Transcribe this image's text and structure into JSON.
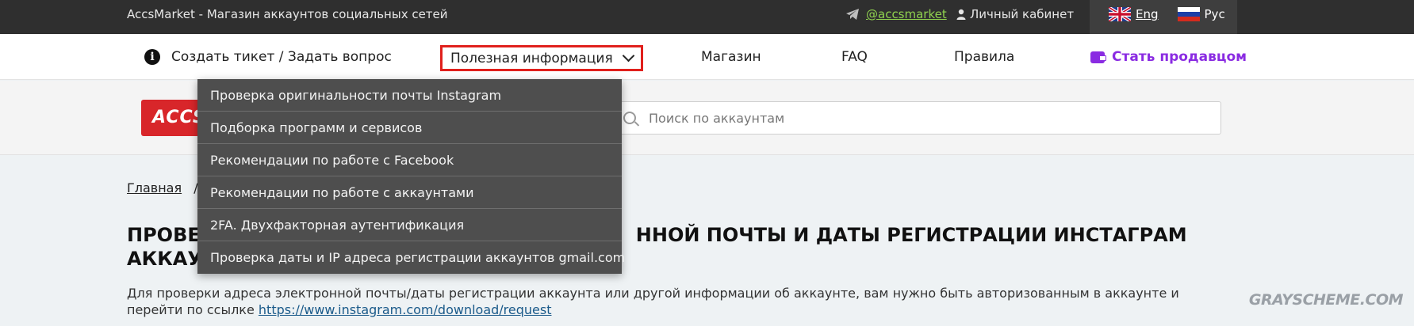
{
  "topbar": {
    "site_title": "AccsMarket - Магазин аккаунтов социальных сетей",
    "telegram_handle": "@accsmarket",
    "cabinet_label": "Личный кабинет",
    "languages": [
      {
        "label": "Eng",
        "flag": "uk-flag-icon"
      },
      {
        "label": "Рус",
        "flag": "ru-flag-icon"
      }
    ]
  },
  "nav": {
    "ticket_label": "Создать тикет / Задать вопрос",
    "useful_label": "Полезная информация",
    "shop_label": "Магазин",
    "faq_label": "FAQ",
    "rules_label": "Правила",
    "seller_label": "Стать продавцом"
  },
  "dropdown": {
    "items": [
      "Проверка оригинальности почты Instagram",
      "Подборка программ и сервисов",
      "Рекомендации по работе с Facebook",
      "Рекомендации по работе с аккаунтами",
      "2FA. Двухфакторная аутентификация",
      "Проверка даты и IP адреса регистрации аккаунтов gmail.com"
    ]
  },
  "band": {
    "logo_text": "ACCS",
    "search_placeholder": "Поиск по аккаунтам"
  },
  "content": {
    "breadcrumb_home": "Главная",
    "breadcrumb_sep": "/",
    "title_line1_left": "ПРОВЕ",
    "title_line1_right": "ННОЙ ПОЧТЫ И ДАТЫ РЕГИСТРАЦИИ ИНСТАГРАМ",
    "title_line2_left": "АККАУ",
    "desc_text": "Для проверки адреса электронной почты/даты регистрации аккаунта или другой информации об аккаунте, вам нужно быть авторизованным в аккаунте и перейти по ссылке",
    "desc_link": "https://www.instagram.com/download/request"
  },
  "watermark": "GRAYSCHEME.COM",
  "colors": {
    "topbar_bg": "#2f2f2f",
    "accent_purple": "#8a2be2",
    "highlight_red": "#e0201c",
    "telegram_green": "#8fd14f",
    "dropdown_bg": "#4e4e4e"
  }
}
